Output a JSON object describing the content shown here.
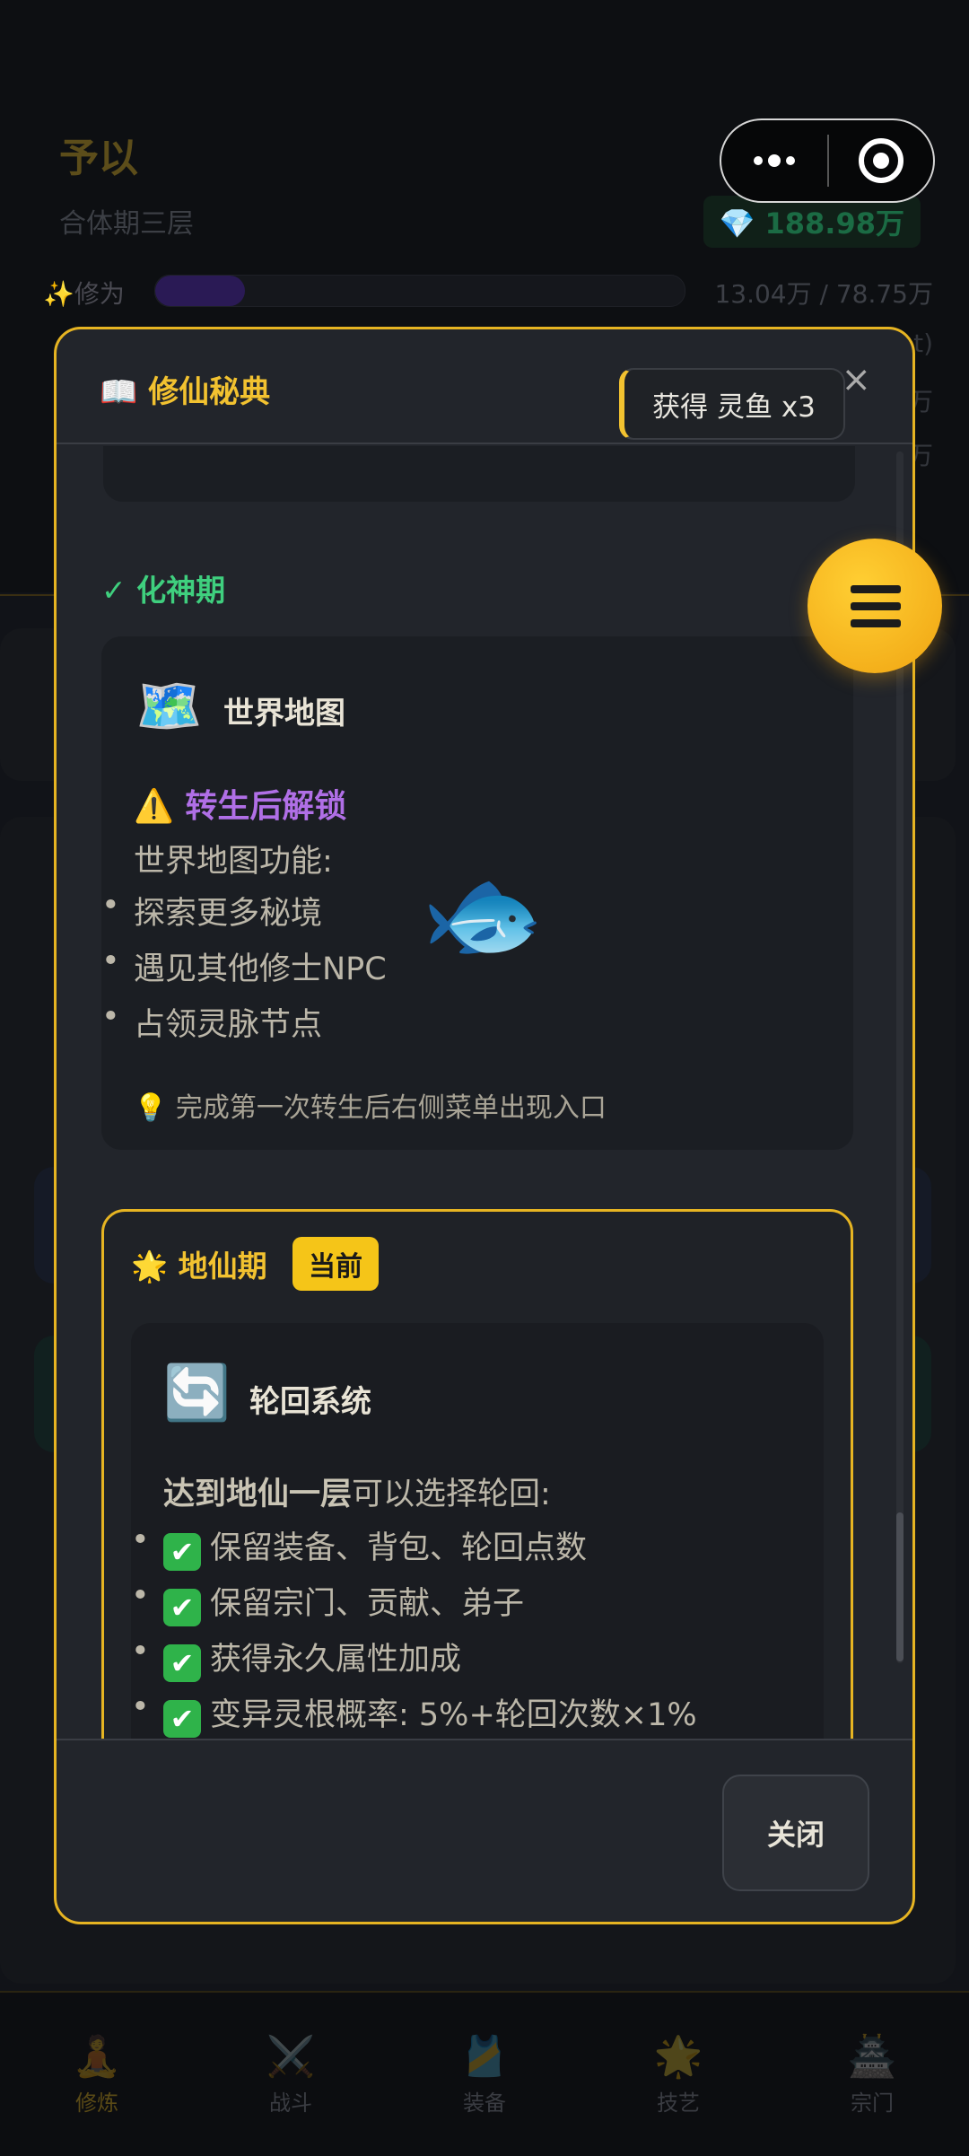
{
  "background": {
    "player_name": "予以",
    "realm": "合体期三层",
    "spirit_stones": "188.98万",
    "cultivation_label": "修为",
    "cultivation_value": "13.04万 / 78.75万",
    "cultivation_progress": 0.17,
    "partial_rows": [
      "t)",
      "万",
      "万"
    ],
    "nav": [
      {
        "icon": "🧘",
        "label": "修炼",
        "active": true
      },
      {
        "icon": "⚔️",
        "label": "战斗",
        "active": false
      },
      {
        "icon": "🎽",
        "label": "装备",
        "active": false
      },
      {
        "icon": "🌟",
        "label": "技艺",
        "active": false
      },
      {
        "icon": "🏯",
        "label": "宗门",
        "active": false
      }
    ]
  },
  "modal": {
    "icon": "📖",
    "title": "修仙秘典",
    "close_symbol": "×",
    "stage1": {
      "check": "✓",
      "name": "化神期",
      "feature": {
        "icon": "🗺️",
        "title": "世界地图",
        "lock_icon": "⚠️",
        "lock_text": "转生后解锁",
        "description": "世界地图功能:",
        "bullets": [
          "探索更多秘境",
          "遇见其他修士NPC",
          "占领灵脉节点"
        ],
        "tip_icon": "💡",
        "tip": "完成第一次转生后右侧菜单出现入口"
      }
    },
    "stage2": {
      "icon": "🌟",
      "name": "地仙期",
      "badge": "当前",
      "feature": {
        "icon": "🔄",
        "title": "轮回系统",
        "lead_bold": "达到地仙一层",
        "lead_rest": "可以选择轮回:",
        "check_icon": "✔",
        "items": [
          "保留装备、背包、轮回点数",
          "保留宗门、贡献、弟子",
          "获得永久属性加成",
          "变异灵根概率: 5%+轮回次数×1%"
        ]
      }
    },
    "close_button": "关闭"
  },
  "toast": "获得 灵鱼 x3",
  "fish_icon": "🐟",
  "accent_color": "#f2c230"
}
